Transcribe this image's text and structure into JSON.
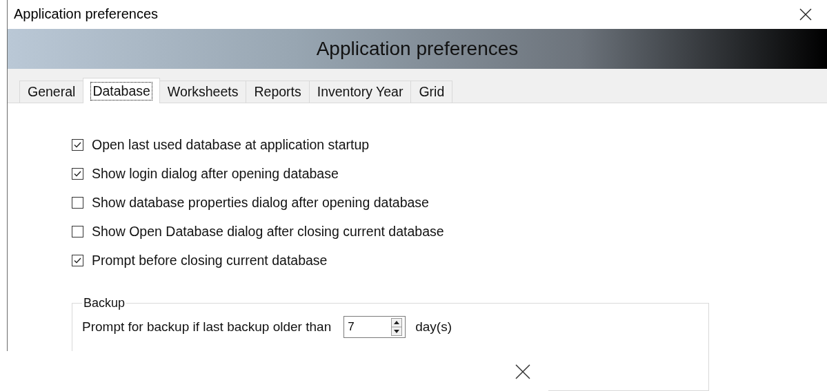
{
  "window": {
    "title": "Application preferences"
  },
  "banner": {
    "title": "Application preferences"
  },
  "tabs": [
    {
      "label": "General",
      "selected": false
    },
    {
      "label": "Database",
      "selected": true
    },
    {
      "label": "Worksheets",
      "selected": false
    },
    {
      "label": "Reports",
      "selected": false
    },
    {
      "label": "Inventory Year",
      "selected": false
    },
    {
      "label": "Grid",
      "selected": false
    }
  ],
  "options": [
    {
      "label": "Open last used database at application startup",
      "checked": true
    },
    {
      "label": "Show login dialog after opening database",
      "checked": true
    },
    {
      "label": "Show database properties dialog after opening database",
      "checked": false
    },
    {
      "label": "Show Open Database dialog after closing current database",
      "checked": false
    },
    {
      "label": "Prompt before closing current database",
      "checked": true
    }
  ],
  "backup": {
    "title": "Backup",
    "prompt_label": "Prompt for backup if last backup older than",
    "days_value": "7",
    "unit": "day(s)"
  }
}
